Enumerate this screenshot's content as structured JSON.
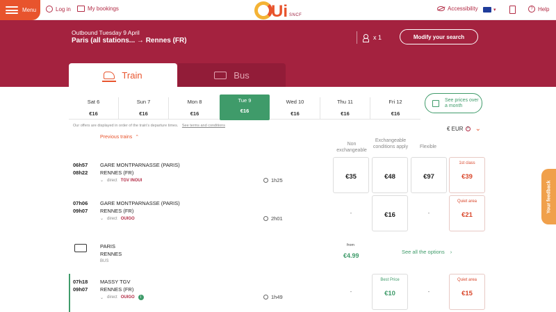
{
  "nav": {
    "menu_label": "Menu",
    "login_label": "Log in",
    "bookings_label": "My bookings",
    "logo_text": "Ui",
    "logo_sub": "SNCF",
    "accessibility_label": "Accessibility",
    "help_label": "Help"
  },
  "search": {
    "outbound": "Outbound Tuesday 9 April",
    "route": "Paris (all stations... → Rennes (FR)",
    "passengers": "x 1",
    "modify_label": "Modify your search"
  },
  "tabs": [
    {
      "label": "Train",
      "active": true
    },
    {
      "label": "Bus",
      "active": false
    }
  ],
  "dates": [
    {
      "day": "Sat 6",
      "price": "€16"
    },
    {
      "day": "Sun 7",
      "price": "€16"
    },
    {
      "day": "Mon 8",
      "price": "€16"
    },
    {
      "day": "Tue 9",
      "price": "€16",
      "selected": true
    },
    {
      "day": "Wed 10",
      "price": "€16"
    },
    {
      "day": "Thu 11",
      "price": "€16"
    },
    {
      "day": "Fri 12",
      "price": "€16"
    }
  ],
  "see_prices_label": "See prices over a month",
  "notice": "Our offers are displayed in order of the train's departure times.",
  "terms_link": "See terms and conditions",
  "currency": "€ EUR",
  "previous_trains": "Previous trains",
  "columns": [
    "Non exchangeable",
    "Exchangeable conditions apply",
    "Flexible"
  ],
  "journeys": [
    {
      "depart": "06h57",
      "arrive": "08h22",
      "from": "GARE MONTPARNASSE (PARIS)",
      "to": "RENNES (FR)",
      "type": "direct",
      "carrier": "TGV INOUI",
      "duration": "1h25",
      "prices": [
        "€35",
        "€48",
        "€97"
      ],
      "extra_tag": "1st class",
      "extra_price": "€39"
    },
    {
      "depart": "07h06",
      "arrive": "09h07",
      "from": "GARE MONTPARNASSE (PARIS)",
      "to": "RENNES (FR)",
      "type": "direct",
      "carrier": "OUIGO",
      "duration": "2h01",
      "prices": [
        "-",
        "€16",
        "-"
      ],
      "extra_tag": "Quiet area",
      "extra_price": "€21"
    },
    {
      "depart": "07h18",
      "arrive": "09h07",
      "from": "MASSY TGV",
      "to": "RENNES (FR)",
      "type": "direct",
      "carrier": "OUIGO",
      "duration": "1h49",
      "best_tag": "Best Price",
      "prices": [
        "-",
        "€10",
        "-"
      ],
      "extra_tag": "Quiet area",
      "extra_price": "€15"
    }
  ],
  "bus_row": {
    "from": "PARIS",
    "to": "RENNES",
    "mode": "BUS",
    "from_label": "from",
    "price": "€4.99",
    "see_all": "See all the options"
  },
  "feedback_label": "Your feedback",
  "colors": {
    "brand": "#a4223f",
    "accent": "#e8542d",
    "green": "#3f9b6a"
  }
}
